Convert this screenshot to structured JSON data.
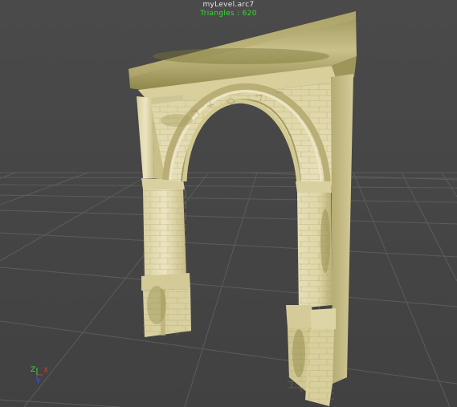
{
  "viewport": {
    "file_name": "myLevel.arc7",
    "triangles_label": "Triangles",
    "triangles_count": "620",
    "triangles_text": "Triangles : 620"
  },
  "gizmo": {
    "axes": [
      {
        "label": "Z",
        "color": "#33dd33"
      },
      {
        "label": "X",
        "color": "#dd3333"
      },
      {
        "label": "Y",
        "color": "#3355ee"
      }
    ]
  },
  "colors": {
    "background": "#4a4a4a",
    "grid": "#5a5a5a",
    "stone_light": "#e3dcb0",
    "stone_dark": "#a89e6a",
    "moss": "#8d8a45"
  },
  "objects": {
    "model": "stone-arch"
  }
}
